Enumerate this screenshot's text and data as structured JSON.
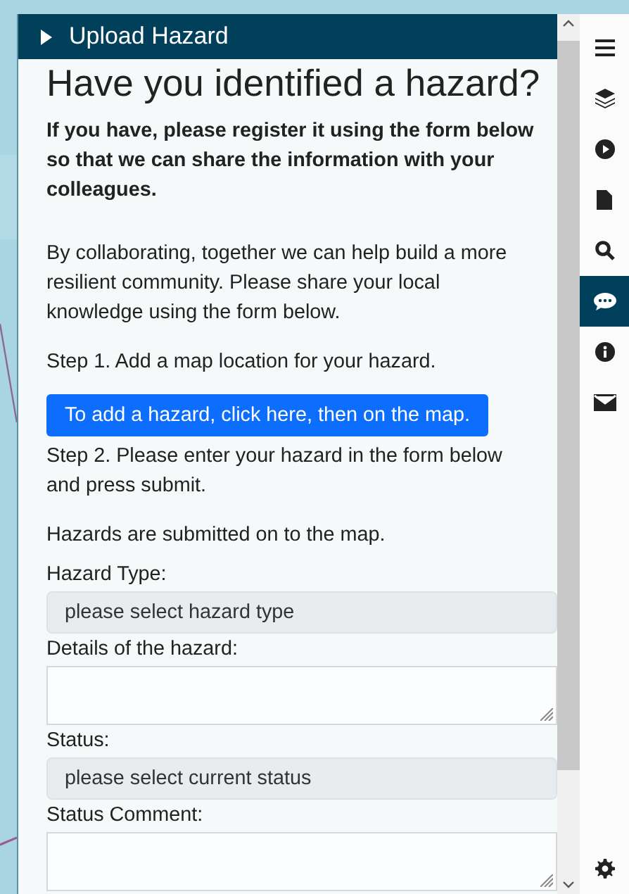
{
  "panel": {
    "title": "Upload Hazard"
  },
  "heading": "Have you identified a hazard?",
  "intro": "If you have, please register it using the form below so that we can share the information with your colleagues.",
  "paragraph": "By collaborating, together we can help build a more resilient community. Please share your local knowledge using the form below.",
  "step_1": "Step 1. Add a map location for your hazard.",
  "add_button": "To add a hazard, click here, then on the map.",
  "step_2": "Step 2. Please enter your hazard in the form below and press submit.",
  "note": "Hazards are submitted on to the map.",
  "fields": [
    {
      "kind": "select",
      "label": "Hazard Type:",
      "value": "please select hazard type"
    },
    {
      "kind": "textarea",
      "label": "Details of the hazard:"
    },
    {
      "kind": "select",
      "label": "Status:",
      "value": "please select current status"
    },
    {
      "kind": "textarea",
      "label": "Status Comment:"
    }
  ],
  "sidebar": {
    "items": [
      {
        "kind": "menu",
        "selected": false
      },
      {
        "kind": "layers",
        "selected": false
      },
      {
        "kind": "play",
        "selected": false
      },
      {
        "kind": "file",
        "selected": false
      },
      {
        "kind": "search",
        "selected": false
      },
      {
        "kind": "comment",
        "selected": true
      },
      {
        "kind": "info",
        "selected": false
      },
      {
        "kind": "mail",
        "selected": false
      }
    ],
    "bottom": {
      "kind": "settings",
      "selected": false
    }
  }
}
